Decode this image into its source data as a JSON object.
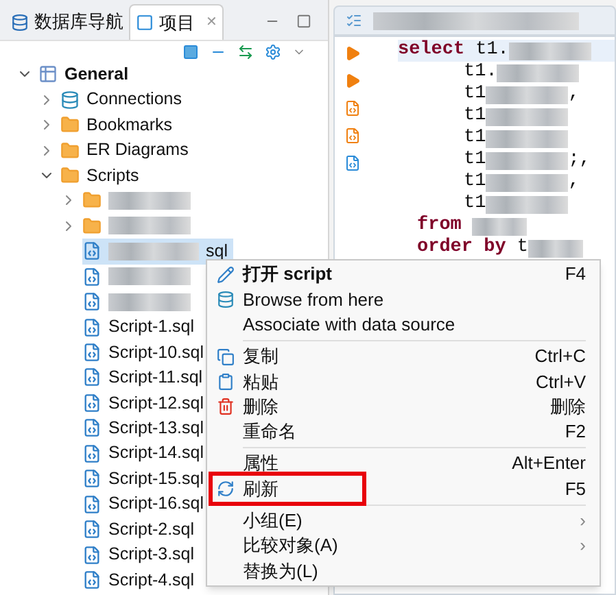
{
  "left_panel": {
    "tabs": [
      {
        "label": "数据库导航",
        "selected": false
      },
      {
        "label": "项目",
        "selected": true,
        "close": "✕"
      }
    ],
    "tree": [
      {
        "label": "General",
        "kind": "project",
        "expanded": true,
        "bold": true,
        "children": [
          {
            "label": "Connections",
            "kind": "connections",
            "expanded": false
          },
          {
            "label": "Bookmarks",
            "kind": "bookmarks",
            "expanded": false
          },
          {
            "label": "ER Diagrams",
            "kind": "diagrams",
            "expanded": false
          },
          {
            "label": "Scripts",
            "kind": "folder",
            "expanded": true,
            "children": [
              {
                "kind": "blurred-folder",
                "expanded": false
              },
              {
                "kind": "blurred-folder",
                "expanded": false
              },
              {
                "kind": "blurred-file",
                "selected": true,
                "suffix": "sql"
              },
              {
                "kind": "blurred-file",
                "selected": false
              },
              {
                "kind": "blurred-file",
                "selected": false
              },
              {
                "label": "Script-1.sql",
                "kind": "file",
                "selected": false
              },
              {
                "label": "Script-10.sql",
                "kind": "file",
                "selected": false
              },
              {
                "label": "Script-11.sql",
                "kind": "file",
                "selected": false
              },
              {
                "label": "Script-12.sql",
                "kind": "file",
                "selected": false
              },
              {
                "label": "Script-13.sql",
                "kind": "file",
                "selected": false
              },
              {
                "label": "Script-14.sql",
                "kind": "file",
                "selected": false
              },
              {
                "label": "Script-15.sql",
                "kind": "file",
                "selected": false
              },
              {
                "label": "Script-16.sql",
                "kind": "file",
                "selected": false
              },
              {
                "label": "Script-2.sql",
                "kind": "file",
                "selected": false
              },
              {
                "label": "Script-3.sql",
                "kind": "file",
                "selected": false
              },
              {
                "label": "Script-4.sql",
                "kind": "file",
                "selected": false
              }
            ]
          }
        ]
      }
    ]
  },
  "editor": {
    "lines": [
      {
        "kind": "statement",
        "keyword": "select",
        "text": "t1."
      },
      {
        "kind": "column",
        "text": "t1."
      },
      {
        "kind": "column",
        "text": "t1",
        "suffix": ","
      },
      {
        "kind": "column",
        "text": "t1"
      },
      {
        "kind": "column",
        "text": "t1"
      },
      {
        "kind": "column",
        "text": "t1",
        "suffix": ";,"
      },
      {
        "kind": "column",
        "text": "t1",
        "suffix": ","
      },
      {
        "kind": "column",
        "text": "t1"
      },
      {
        "kind": "clause",
        "keyword": "from"
      },
      {
        "kind": "clause",
        "keyword": "order by",
        "text": "t"
      }
    ]
  },
  "context_menu": {
    "items": [
      {
        "kind": "open",
        "label": "打开 script",
        "shortcut": "F4",
        "bold": true
      },
      {
        "kind": "browse",
        "label": "Browse from here"
      },
      {
        "kind": "plain",
        "label": "Associate with data source"
      },
      {
        "kind": "separator"
      },
      {
        "kind": "copy",
        "label": "复制",
        "shortcut": "Ctrl+C"
      },
      {
        "kind": "paste",
        "label": "粘贴",
        "shortcut": "Ctrl+V"
      },
      {
        "kind": "delete",
        "label": "删除",
        "shortcut": "删除"
      },
      {
        "kind": "plain",
        "label": "重命名",
        "shortcut": "F2"
      },
      {
        "kind": "separator"
      },
      {
        "kind": "plain",
        "label": "属性",
        "shortcut": "Alt+Enter"
      },
      {
        "kind": "refresh",
        "label": "刷新",
        "shortcut": "F5",
        "highlighted": true
      },
      {
        "kind": "separator"
      },
      {
        "kind": "plain",
        "label": "小组(E)",
        "submenu": "›"
      },
      {
        "kind": "plain",
        "label": "比较对象(A)",
        "submenu": "›"
      },
      {
        "kind": "plain",
        "label": "替换为(L)"
      }
    ]
  }
}
